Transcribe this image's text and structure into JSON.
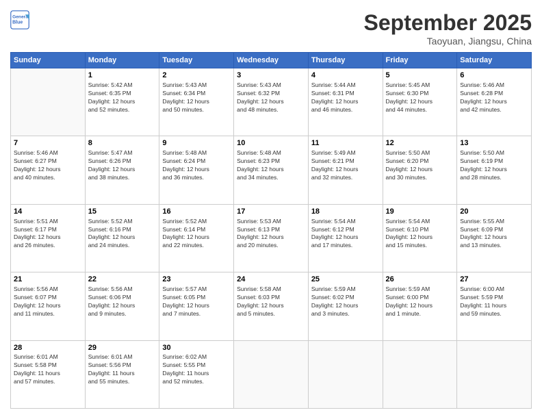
{
  "header": {
    "logo_line1": "General",
    "logo_line2": "Blue",
    "month": "September 2025",
    "location": "Taoyuan, Jiangsu, China"
  },
  "weekdays": [
    "Sunday",
    "Monday",
    "Tuesday",
    "Wednesday",
    "Thursday",
    "Friday",
    "Saturday"
  ],
  "weeks": [
    [
      {
        "day": "",
        "info": ""
      },
      {
        "day": "1",
        "info": "Sunrise: 5:42 AM\nSunset: 6:35 PM\nDaylight: 12 hours\nand 52 minutes."
      },
      {
        "day": "2",
        "info": "Sunrise: 5:43 AM\nSunset: 6:34 PM\nDaylight: 12 hours\nand 50 minutes."
      },
      {
        "day": "3",
        "info": "Sunrise: 5:43 AM\nSunset: 6:32 PM\nDaylight: 12 hours\nand 48 minutes."
      },
      {
        "day": "4",
        "info": "Sunrise: 5:44 AM\nSunset: 6:31 PM\nDaylight: 12 hours\nand 46 minutes."
      },
      {
        "day": "5",
        "info": "Sunrise: 5:45 AM\nSunset: 6:30 PM\nDaylight: 12 hours\nand 44 minutes."
      },
      {
        "day": "6",
        "info": "Sunrise: 5:46 AM\nSunset: 6:28 PM\nDaylight: 12 hours\nand 42 minutes."
      }
    ],
    [
      {
        "day": "7",
        "info": "Sunrise: 5:46 AM\nSunset: 6:27 PM\nDaylight: 12 hours\nand 40 minutes."
      },
      {
        "day": "8",
        "info": "Sunrise: 5:47 AM\nSunset: 6:26 PM\nDaylight: 12 hours\nand 38 minutes."
      },
      {
        "day": "9",
        "info": "Sunrise: 5:48 AM\nSunset: 6:24 PM\nDaylight: 12 hours\nand 36 minutes."
      },
      {
        "day": "10",
        "info": "Sunrise: 5:48 AM\nSunset: 6:23 PM\nDaylight: 12 hours\nand 34 minutes."
      },
      {
        "day": "11",
        "info": "Sunrise: 5:49 AM\nSunset: 6:21 PM\nDaylight: 12 hours\nand 32 minutes."
      },
      {
        "day": "12",
        "info": "Sunrise: 5:50 AM\nSunset: 6:20 PM\nDaylight: 12 hours\nand 30 minutes."
      },
      {
        "day": "13",
        "info": "Sunrise: 5:50 AM\nSunset: 6:19 PM\nDaylight: 12 hours\nand 28 minutes."
      }
    ],
    [
      {
        "day": "14",
        "info": "Sunrise: 5:51 AM\nSunset: 6:17 PM\nDaylight: 12 hours\nand 26 minutes."
      },
      {
        "day": "15",
        "info": "Sunrise: 5:52 AM\nSunset: 6:16 PM\nDaylight: 12 hours\nand 24 minutes."
      },
      {
        "day": "16",
        "info": "Sunrise: 5:52 AM\nSunset: 6:14 PM\nDaylight: 12 hours\nand 22 minutes."
      },
      {
        "day": "17",
        "info": "Sunrise: 5:53 AM\nSunset: 6:13 PM\nDaylight: 12 hours\nand 20 minutes."
      },
      {
        "day": "18",
        "info": "Sunrise: 5:54 AM\nSunset: 6:12 PM\nDaylight: 12 hours\nand 17 minutes."
      },
      {
        "day": "19",
        "info": "Sunrise: 5:54 AM\nSunset: 6:10 PM\nDaylight: 12 hours\nand 15 minutes."
      },
      {
        "day": "20",
        "info": "Sunrise: 5:55 AM\nSunset: 6:09 PM\nDaylight: 12 hours\nand 13 minutes."
      }
    ],
    [
      {
        "day": "21",
        "info": "Sunrise: 5:56 AM\nSunset: 6:07 PM\nDaylight: 12 hours\nand 11 minutes."
      },
      {
        "day": "22",
        "info": "Sunrise: 5:56 AM\nSunset: 6:06 PM\nDaylight: 12 hours\nand 9 minutes."
      },
      {
        "day": "23",
        "info": "Sunrise: 5:57 AM\nSunset: 6:05 PM\nDaylight: 12 hours\nand 7 minutes."
      },
      {
        "day": "24",
        "info": "Sunrise: 5:58 AM\nSunset: 6:03 PM\nDaylight: 12 hours\nand 5 minutes."
      },
      {
        "day": "25",
        "info": "Sunrise: 5:59 AM\nSunset: 6:02 PM\nDaylight: 12 hours\nand 3 minutes."
      },
      {
        "day": "26",
        "info": "Sunrise: 5:59 AM\nSunset: 6:00 PM\nDaylight: 12 hours\nand 1 minute."
      },
      {
        "day": "27",
        "info": "Sunrise: 6:00 AM\nSunset: 5:59 PM\nDaylight: 11 hours\nand 59 minutes."
      }
    ],
    [
      {
        "day": "28",
        "info": "Sunrise: 6:01 AM\nSunset: 5:58 PM\nDaylight: 11 hours\nand 57 minutes."
      },
      {
        "day": "29",
        "info": "Sunrise: 6:01 AM\nSunset: 5:56 PM\nDaylight: 11 hours\nand 55 minutes."
      },
      {
        "day": "30",
        "info": "Sunrise: 6:02 AM\nSunset: 5:55 PM\nDaylight: 11 hours\nand 52 minutes."
      },
      {
        "day": "",
        "info": ""
      },
      {
        "day": "",
        "info": ""
      },
      {
        "day": "",
        "info": ""
      },
      {
        "day": "",
        "info": ""
      }
    ]
  ]
}
